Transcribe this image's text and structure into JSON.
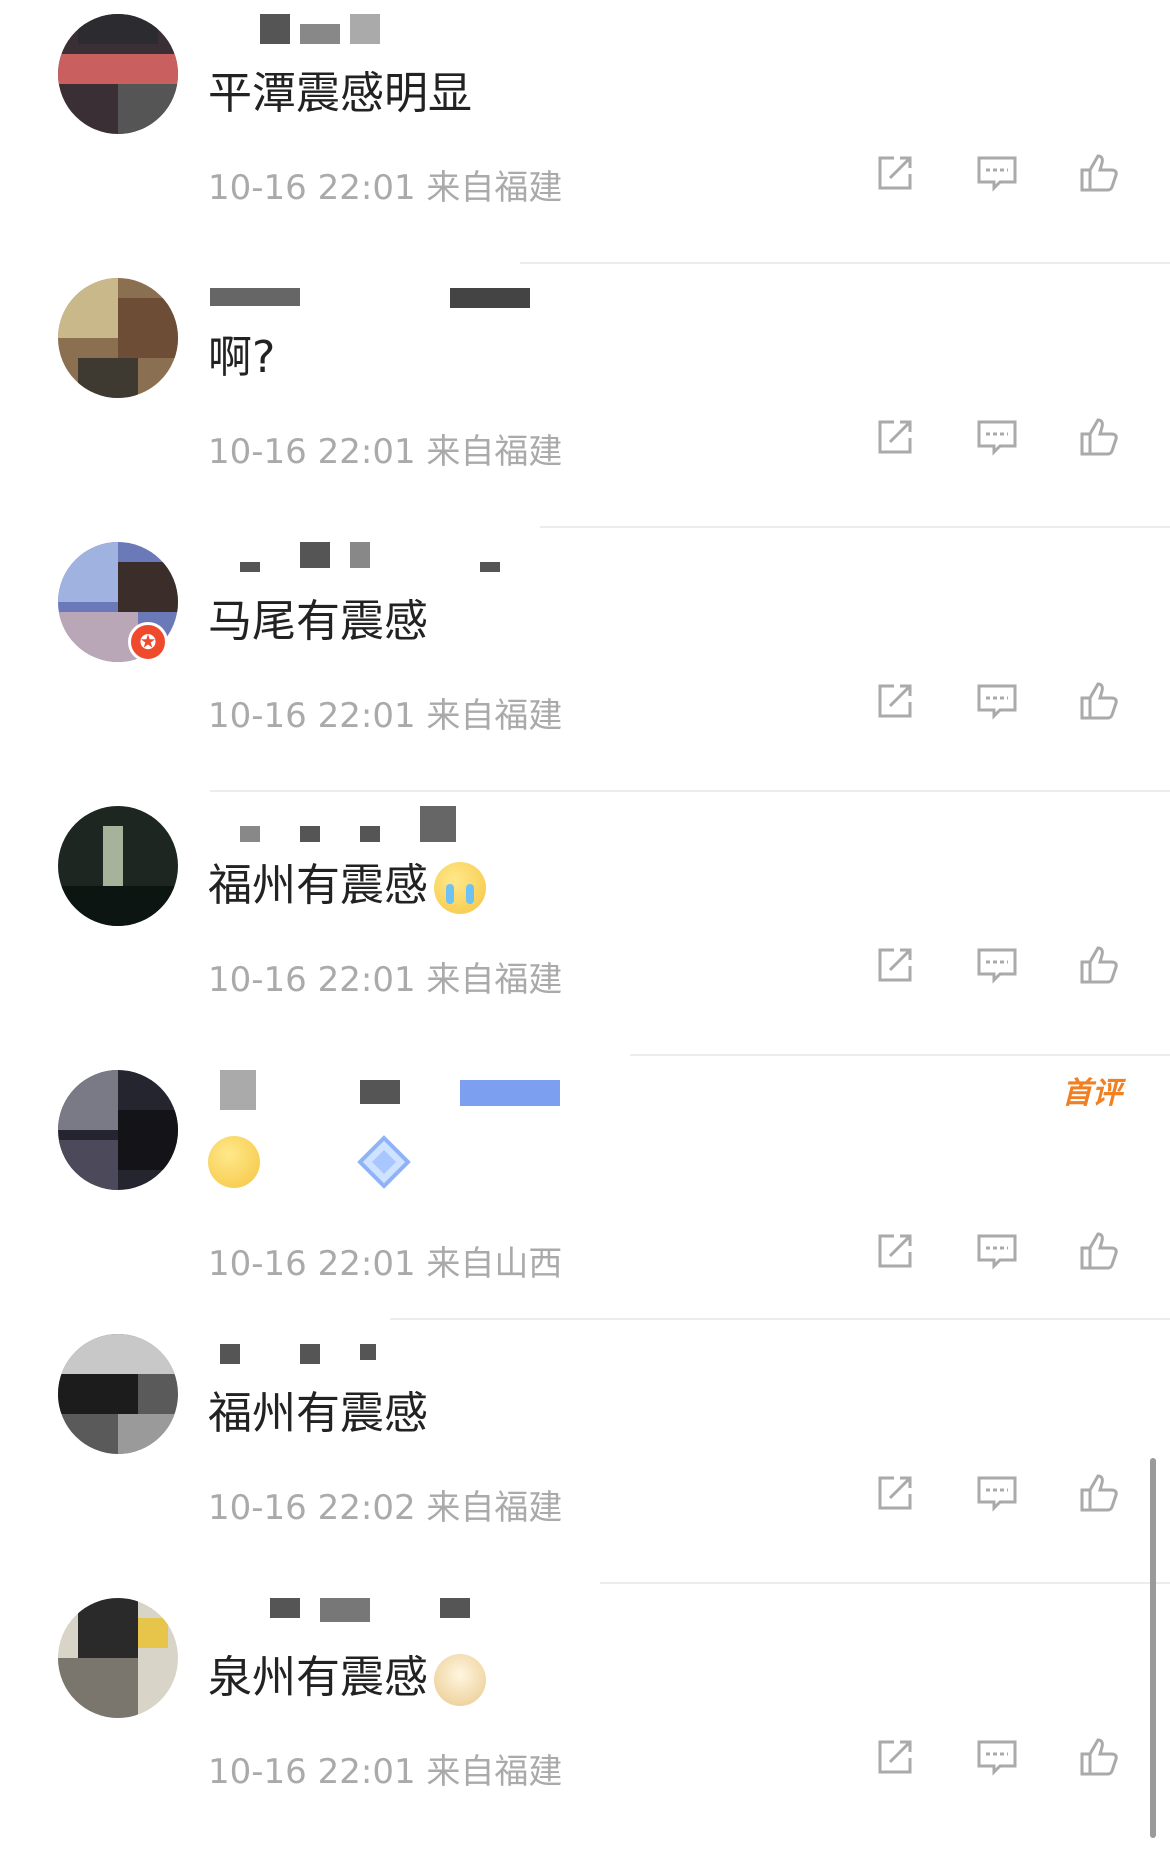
{
  "comments": [
    {
      "text": "平潭震感明显",
      "emoji": "",
      "time": "10-16 22:01",
      "location": "来自福建",
      "first": ""
    },
    {
      "text": "啊?",
      "emoji": "",
      "time": "10-16 22:01",
      "location": "来自福建",
      "first": ""
    },
    {
      "text": "马尾有震感",
      "emoji": "",
      "time": "10-16 22:01",
      "location": "来自福建",
      "first": "",
      "verified": true
    },
    {
      "text": "福州有震感",
      "emoji": "crying-face-emoji",
      "time": "10-16 22:01",
      "location": "来自福建",
      "first": ""
    },
    {
      "text": "",
      "emoji": "sweat-face-emoji",
      "time": "10-16 22:01",
      "location": "来自山西",
      "first": "首评"
    },
    {
      "text": "福州有震感",
      "emoji": "",
      "time": "10-16 22:02",
      "location": "来自福建",
      "first": ""
    },
    {
      "text": "泉州有震感",
      "emoji": "doge-emoji",
      "time": "10-16 22:01",
      "location": "来自福建",
      "first": ""
    }
  ],
  "icons": {
    "share": "share-icon",
    "reply": "comment-icon",
    "like": "thumbs-up-icon"
  },
  "colors": {
    "meta": "#aaaaaa",
    "text": "#222222",
    "first_badge": "#f08022",
    "divider": "#ececec"
  }
}
